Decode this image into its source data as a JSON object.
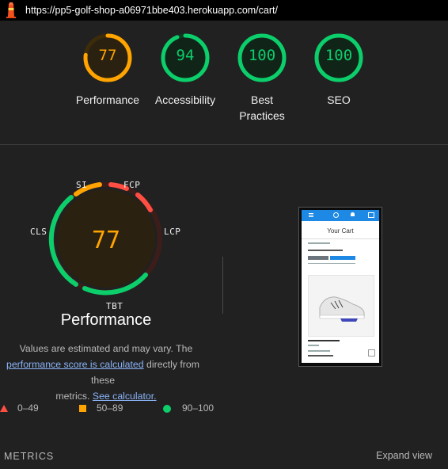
{
  "url_bar": {
    "url": "https://pp5-golf-shop-a06971bbe403.herokuapp.com/cart/"
  },
  "gauges": [
    {
      "label": "Performance",
      "score": "77",
      "percent": 0.77,
      "color": "#ffa400"
    },
    {
      "label": "Accessibility",
      "score": "94",
      "percent": 0.94,
      "color": "#0cce6b"
    },
    {
      "label": "Best Practices",
      "score": "100",
      "percent": 1.0,
      "color": "#0cce6b"
    },
    {
      "label": "SEO",
      "score": "100",
      "percent": 1.0,
      "color": "#0cce6b"
    }
  ],
  "performance": {
    "score": "77",
    "title": "Performance",
    "metric_labels": {
      "si": "SI",
      "fcp": "FCP",
      "lcp": "LCP",
      "tbt": "TBT",
      "cls": "CLS"
    },
    "desc_line1": "Values are estimated and may vary. The",
    "desc_link1": "performance score is calculated",
    "desc_text2": " directly from these",
    "desc_line3": "metrics. ",
    "desc_link2": "See calculator."
  },
  "legend": {
    "fail": "0–49",
    "average": "50–89",
    "pass": "90–100",
    "colors": {
      "fail": "#ff4e42",
      "average": "#ffa400",
      "pass": "#0cce6b"
    }
  },
  "screenshot_preview": {
    "title": "Your Cart"
  },
  "footer": {
    "metrics_label": "METRICS",
    "expand_label": "Expand view"
  }
}
